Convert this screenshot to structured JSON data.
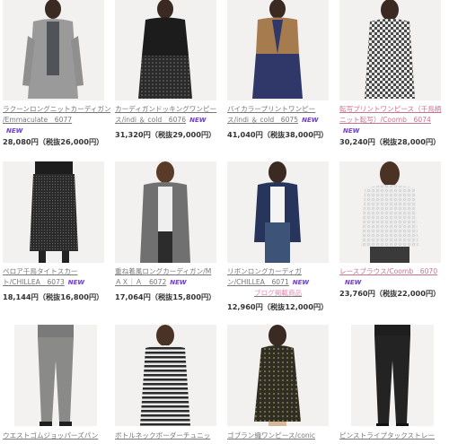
{
  "products": [
    {
      "name_l1": "ラクーンロングニットカーディガン",
      "name_l2": "/Emmaculate　6077",
      "new": "NEW",
      "price": "28,080円（税抜26,000円）",
      "note": ""
    },
    {
      "name_l1": "カーディガンドッキングワンピー",
      "name_l2": "ス/indi ＆ cold　6076",
      "new": "NEW",
      "price": "31,320円（税抜29,000円）",
      "note": ""
    },
    {
      "name_l1": "バイカラープリントワンピー",
      "name_l2": "ス/indi ＆ cold　6075",
      "new": "NEW",
      "price": "41,040円（税抜38,000円）",
      "note": ""
    },
    {
      "name_l1": "転写プリントワンピース（千鳥柄",
      "name_l2": "ニット転写）/Coomb　6074",
      "new": "NEW",
      "price": "30,240円（税抜28,000円）",
      "note": ""
    },
    {
      "name_l1": "ペロア千鳥タイトスカー",
      "name_l2": "ト/CHILLEA　6073",
      "new": "NEW",
      "price": "18,144円（税抜16,800円）",
      "note": ""
    },
    {
      "name_l1": "重ね着風ロングカーディガン/M",
      "name_l2": "ＡＸ｜Ａ　6072",
      "new": "NEW",
      "price": "17,064円（税抜15,800円）",
      "note": ""
    },
    {
      "name_l1": "リボンロングカーディガ",
      "name_l2": "ン/CHILLEA　6071",
      "new": "NEW",
      "price": "12,960円（税抜12,000円）",
      "note": "ブログ掲載商品"
    },
    {
      "name_l1": "レースブラウス/Coomb　6070",
      "name_l2": "",
      "new": "NEW",
      "price": "23,760円（税抜22,000円）",
      "note": ""
    },
    {
      "name_l1": "ウエストゴムジョッパーズパン",
      "name_l2": "",
      "new": "",
      "price": "",
      "note": ""
    },
    {
      "name_l1": "ボトルネックボーダーチュニッ",
      "name_l2": "",
      "new": "",
      "price": "",
      "note": ""
    },
    {
      "name_l1": "ゴブラン織ワンピース/conic",
      "name_l2": "",
      "new": "",
      "price": "",
      "note": ""
    },
    {
      "name_l1": "ピンストライプタックストレー",
      "name_l2": "",
      "new": "",
      "price": "",
      "note": ""
    }
  ],
  "colors": {
    "bg": "#ffffff",
    "link": "#777777",
    "price": "#333333",
    "note": "#e98ab6"
  }
}
